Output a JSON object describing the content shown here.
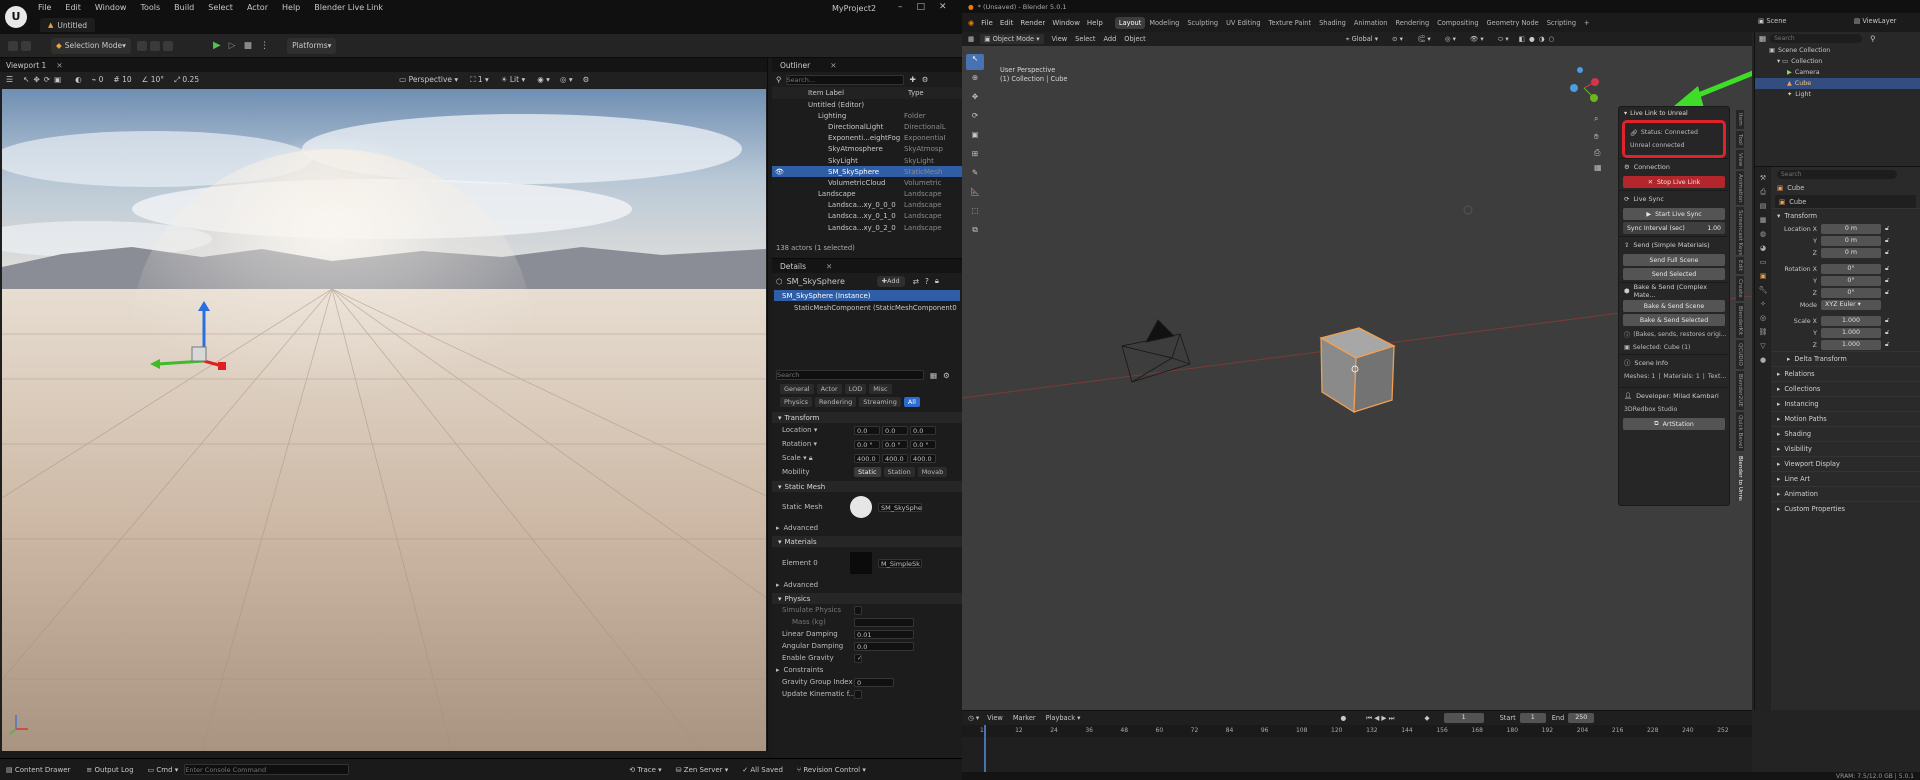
{
  "ue": {
    "menu": [
      "File",
      "Edit",
      "Window",
      "Tools",
      "Build",
      "Select",
      "Actor",
      "Help",
      "Blender Live Link"
    ],
    "tab_title": "Untitled",
    "project_name": "MyProject2",
    "toolbar": {
      "selection_mode": "Selection Mode",
      "platforms": "Platforms"
    },
    "viewport": {
      "tab": "Viewport 1",
      "perspective": "Perspective",
      "lit": "Lit",
      "snap_grid": "10",
      "snap_rot": "10°",
      "snap_scale": "0.25",
      "cam_speed": "1",
      "zero": "0"
    },
    "outliner": {
      "tab": "Outliner",
      "search_placeholder": "Search...",
      "col_item": "Item Label",
      "col_type": "Type",
      "rows": [
        {
          "name": "Untitled (Editor)",
          "type": "",
          "indent": 0
        },
        {
          "name": "Lighting",
          "type": "Folder",
          "indent": 1
        },
        {
          "name": "DirectionalLight",
          "type": "DirectionalL",
          "indent": 2
        },
        {
          "name": "Exponenti...eightFog",
          "type": "ExponentiaI",
          "indent": 2
        },
        {
          "name": "SkyAtmosphere",
          "type": "SkyAtmosp",
          "indent": 2
        },
        {
          "name": "SkyLight",
          "type": "SkyLight",
          "indent": 2
        },
        {
          "name": "SM_SkySphere",
          "type": "StaticMesh",
          "indent": 2,
          "selected": true
        },
        {
          "name": "VolumetricCloud",
          "type": "Volumetric",
          "indent": 2
        },
        {
          "name": "Landscape",
          "type": "Landscape",
          "indent": 1
        },
        {
          "name": "Landsca...xy_0_0_0",
          "type": "Landscape",
          "indent": 2
        },
        {
          "name": "Landsca...xy_0_1_0",
          "type": "Landscape",
          "indent": 2
        },
        {
          "name": "Landsca...xy_0_2_0",
          "type": "Landscape",
          "indent": 2
        }
      ],
      "footer": "138 actors (1 selected)"
    },
    "details": {
      "tab": "Details",
      "actor": "SM_SkySphere",
      "add": "Add",
      "instance": "SM_SkySphere (Instance)",
      "component": "StaticMeshComponent (StaticMeshComponent0",
      "search_placeholder": "Search",
      "filters_row1": [
        "General",
        "Actor",
        "LOD",
        "Misc"
      ],
      "filters_row2": [
        "Physics",
        "Rendering",
        "Streaming",
        "All"
      ],
      "transform": "Transform",
      "location": "Location",
      "rotation": "Rotation",
      "scale": "Scale",
      "loc": [
        "0.0",
        "0.0",
        "0.0"
      ],
      "rot": [
        "0.0 °",
        "0.0 °",
        "0.0 °"
      ],
      "scl": [
        "400.0",
        "400.0",
        "400.0"
      ],
      "mobility": "Mobility",
      "mobility_opts": [
        "Static",
        "Station",
        "Movab"
      ],
      "static_mesh_sec": "Static Mesh",
      "static_mesh": "Static Mesh",
      "mesh_value": "SM_SkySphe",
      "advanced": "Advanced",
      "materials": "Materials",
      "element0": "Element 0",
      "mat_value": "M_SimpleSk",
      "advanced2": "Advanced",
      "physics": "Physics",
      "simulate": "Simulate Physics",
      "mass": "Mass (kg)",
      "lin_damp": "Linear Damping",
      "lin_damp_v": "0.01",
      "ang_damp": "Angular Damping",
      "ang_damp_v": "0.0",
      "gravity": "Enable Gravity",
      "constraints": "Constraints",
      "grav_group": "Gravity Group Index",
      "grav_group_v": "0",
      "kinematic": "Update Kinematic f..."
    },
    "bottom": {
      "content_drawer": "Content Drawer",
      "output_log": "Output Log",
      "cmd": "Cmd",
      "cmd_placeholder": "Enter Console Command",
      "trace": "Trace",
      "zen": "Zen Server",
      "saved": "All Saved",
      "revision": "Revision Control"
    }
  },
  "bl": {
    "title": "* (Unsaved) - Blender 5.0.1",
    "menu": [
      "File",
      "Edit",
      "Render",
      "Window",
      "Help"
    ],
    "workspaces": [
      "Layout",
      "Modeling",
      "Sculpting",
      "UV Editing",
      "Texture Paint",
      "Shading",
      "Animation",
      "Rendering",
      "Compositing",
      "Geometry Node",
      "Scripting"
    ],
    "scene": "Scene",
    "view_layer": "ViewLayer",
    "header": {
      "mode": "Object Mode",
      "view": "View",
      "select": "Select",
      "add": "Add",
      "object": "Object",
      "orientation": "Global",
      "options": "Options"
    },
    "viewport": {
      "line1": "User Perspective",
      "line2": "(1) Collection | Cube"
    },
    "npanel": {
      "title": "Live Link to Unreal",
      "status": "Status: Connected",
      "connected": "Unreal connected",
      "connection": "Connection",
      "stop": "Stop Live Link",
      "live_sync": "Live Sync",
      "start_sync": "Start Live Sync",
      "sync_interval": "Sync Interval (sec)",
      "sync_value": "1.00",
      "send_simple": "Send (Simple Materials)",
      "send_full": "Send Full Scene",
      "send_selected": "Send Selected",
      "bake_complex": "Bake & Send (Complex Mate...",
      "bake_scene": "Bake & Send Scene",
      "bake_selected": "Bake & Send Selected",
      "bakes_note": "(Bakes, sends, restores origi...",
      "selected": "Selected: Cube (1)",
      "scene_info": "Scene Info",
      "meshes": "Meshes: 1",
      "materials": "Materials: 1",
      "text": "Text...",
      "developer": "Developer: Milad Kambari",
      "studio": "3DRedbox Studio",
      "artstation": "ArtStation"
    },
    "tabs": [
      "Item",
      "Tool",
      "View",
      "Animation",
      "Screencast Keys",
      "Edit",
      "Create",
      "BlenderKit",
      "QCUDIO",
      "Blender2UE",
      "Quick Bevel",
      "Blender to Unreal"
    ],
    "outliner": {
      "search_placeholder": "Search",
      "scene_collection": "Scene Collection",
      "collection": "Collection",
      "items": [
        "Camera",
        "Cube",
        "Light"
      ]
    },
    "props": {
      "search_placeholder": "Search",
      "object": "Cube",
      "object_name": "Cube",
      "transform": "Transform",
      "location_x": "Location X",
      "y": "Y",
      "z": "Z",
      "loc": [
        "0 m",
        "0 m",
        "0 m"
      ],
      "rotation_x": "Rotation X",
      "rot": [
        "0°",
        "0°",
        "0°"
      ],
      "mode": "Mode",
      "mode_value": "XYZ Euler",
      "scale_x": "Scale X",
      "scl": [
        "1.000",
        "1.000",
        "1.000"
      ],
      "delta": "Delta Transform",
      "sections": [
        "Relations",
        "Collections",
        "Instancing",
        "Motion Paths",
        "Shading",
        "Visibility",
        "Viewport Display",
        "Line Art",
        "Animation",
        "Custom Properties"
      ]
    },
    "timeline": {
      "view": "View",
      "marker": "Marker",
      "playback": "Playback",
      "frame": "1",
      "start_lbl": "Start",
      "start": "1",
      "end_lbl": "End",
      "end": "250",
      "ticks": [
        "1",
        "12",
        "24",
        "36",
        "48",
        "60",
        "72",
        "84",
        "96",
        "108",
        "120",
        "132",
        "144",
        "156",
        "168",
        "180",
        "192",
        "204",
        "216",
        "228",
        "240",
        "252"
      ]
    },
    "status": "VRAM: 7.5/12.0 GB | 5.0.1",
    "colors": {
      "annot_red": "#e0222c",
      "annot_green": "#3fdc2a",
      "stop_red": "#b3262b",
      "accent": "#4772b3"
    }
  }
}
